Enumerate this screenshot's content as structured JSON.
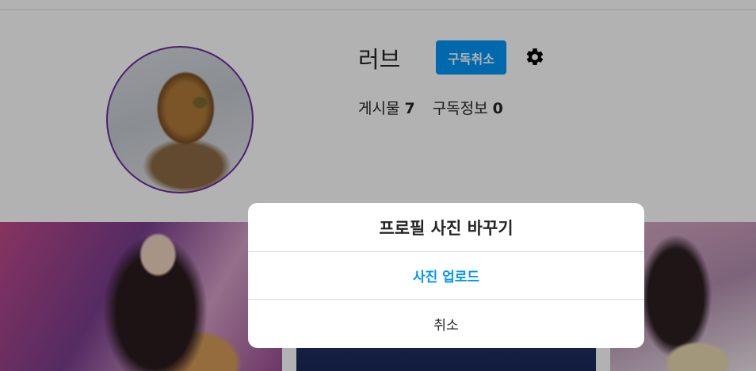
{
  "profile": {
    "username": "러브",
    "unsubscribe_label": "구독취소",
    "settings_icon": "gear-icon",
    "stats": {
      "posts_label": "게시물",
      "posts_count": "7",
      "subscriptions_label": "구독정보",
      "subscriptions_count": "0"
    }
  },
  "modal": {
    "title": "프로필 사진 바꾸기",
    "upload_label": "사진 업로드",
    "cancel_label": "취소"
  },
  "colors": {
    "accent": "#0095f6",
    "avatar_ring": "#6b2fa0",
    "overlay": "rgba(0,0,0,0.3)"
  }
}
